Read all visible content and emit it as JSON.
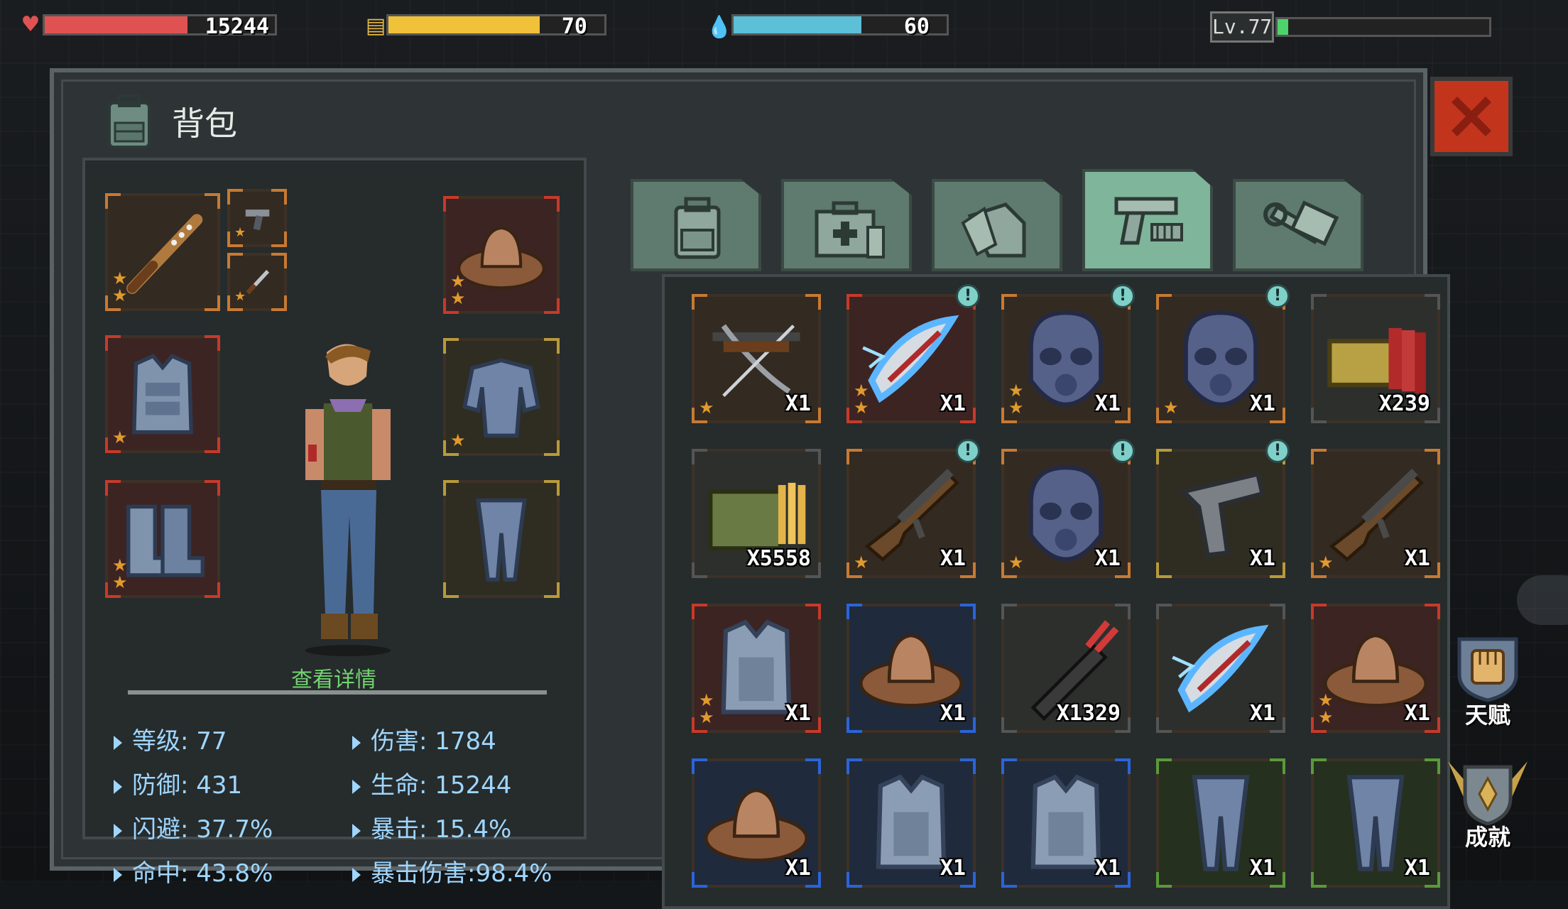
{
  "hud": {
    "health": {
      "value": "15244",
      "fill": 0.62,
      "color": "#e05252"
    },
    "hunger": {
      "value": "70",
      "fill": 0.7,
      "color": "#f0c23a"
    },
    "water": {
      "value": "60",
      "fill": 0.6,
      "color": "#5bc0d8"
    },
    "level": {
      "label": "Lv.77",
      "fill": 0.05,
      "color": "#4cd46a"
    }
  },
  "panel": {
    "title": "背包",
    "details_link": "查看详情"
  },
  "stats": {
    "level": "等级: 77",
    "damage": "伤害: 1784",
    "defense": "防御: 431",
    "health": "生命: 15244",
    "dodge": "闪避: 37.7%",
    "crit": "暴击: 15.4%",
    "hit": "命中: 43.8%",
    "crit_damage": "暴击伤害:98.4%"
  },
  "tabs": [
    {
      "icon": "backpack-icon",
      "active": false
    },
    {
      "icon": "medkit-icon",
      "active": false
    },
    {
      "icon": "food-icon",
      "active": false
    },
    {
      "icon": "weapon-icon",
      "active": true
    },
    {
      "icon": "tools-icon",
      "active": false
    }
  ],
  "inventory": [
    {
      "icon": "crossbow-icon",
      "qty": "X1",
      "rarity": "orange",
      "stars": 1,
      "info": false
    },
    {
      "icon": "lightning-blade-icon",
      "qty": "X1",
      "rarity": "red",
      "stars": 2,
      "info": true
    },
    {
      "icon": "gas-mask-helmet-icon",
      "qty": "X1",
      "rarity": "orange",
      "stars": 2,
      "info": true
    },
    {
      "icon": "gas-mask-helmet-icon",
      "qty": "X1",
      "rarity": "orange",
      "stars": 1,
      "info": true
    },
    {
      "icon": "shotgun-ammo-icon",
      "qty": "X239",
      "rarity": "dark",
      "stars": 0,
      "info": false
    },
    {
      "icon": "rifle-ammo-icon",
      "qty": "X5558",
      "rarity": "dark",
      "stars": 0,
      "info": false
    },
    {
      "icon": "ak-rifle-icon",
      "qty": "X1",
      "rarity": "orange",
      "stars": 1,
      "info": true
    },
    {
      "icon": "gas-mask-helmet-icon",
      "qty": "X1",
      "rarity": "orange",
      "stars": 1,
      "info": true
    },
    {
      "icon": "pistol-icon",
      "qty": "X1",
      "rarity": "gold",
      "stars": 0,
      "info": true
    },
    {
      "icon": "ak-rifle-icon",
      "qty": "X1",
      "rarity": "orange",
      "stars": 1,
      "info": false
    },
    {
      "icon": "armor-vest-icon",
      "qty": "X1",
      "rarity": "red",
      "stars": 2,
      "info": false
    },
    {
      "icon": "cowboy-hat-icon",
      "qty": "X1",
      "rarity": "blue",
      "stars": 0,
      "info": false
    },
    {
      "icon": "arrow-quiver-icon",
      "qty": "X1329",
      "rarity": "dark",
      "stars": 0,
      "info": false
    },
    {
      "icon": "lightning-blade-icon",
      "qty": "X1",
      "rarity": "dark",
      "stars": 0,
      "info": false
    },
    {
      "icon": "cowboy-hat-icon",
      "qty": "X1",
      "rarity": "red",
      "stars": 2,
      "info": false
    },
    {
      "icon": "cowboy-hat-icon",
      "qty": "X1",
      "rarity": "blue",
      "stars": 0,
      "info": false
    },
    {
      "icon": "armor-vest-icon",
      "qty": "X1",
      "rarity": "blue",
      "stars": 0,
      "info": false
    },
    {
      "icon": "armor-vest-icon",
      "qty": "X1",
      "rarity": "blue",
      "stars": 0,
      "info": false
    },
    {
      "icon": "armor-legs-icon",
      "qty": "X1",
      "rarity": "green",
      "stars": 0,
      "info": false
    },
    {
      "icon": "armor-legs-icon",
      "qty": "X1",
      "rarity": "green",
      "stars": 0,
      "info": false
    }
  ],
  "side": {
    "talent": "天赋",
    "achievement": "成就"
  }
}
